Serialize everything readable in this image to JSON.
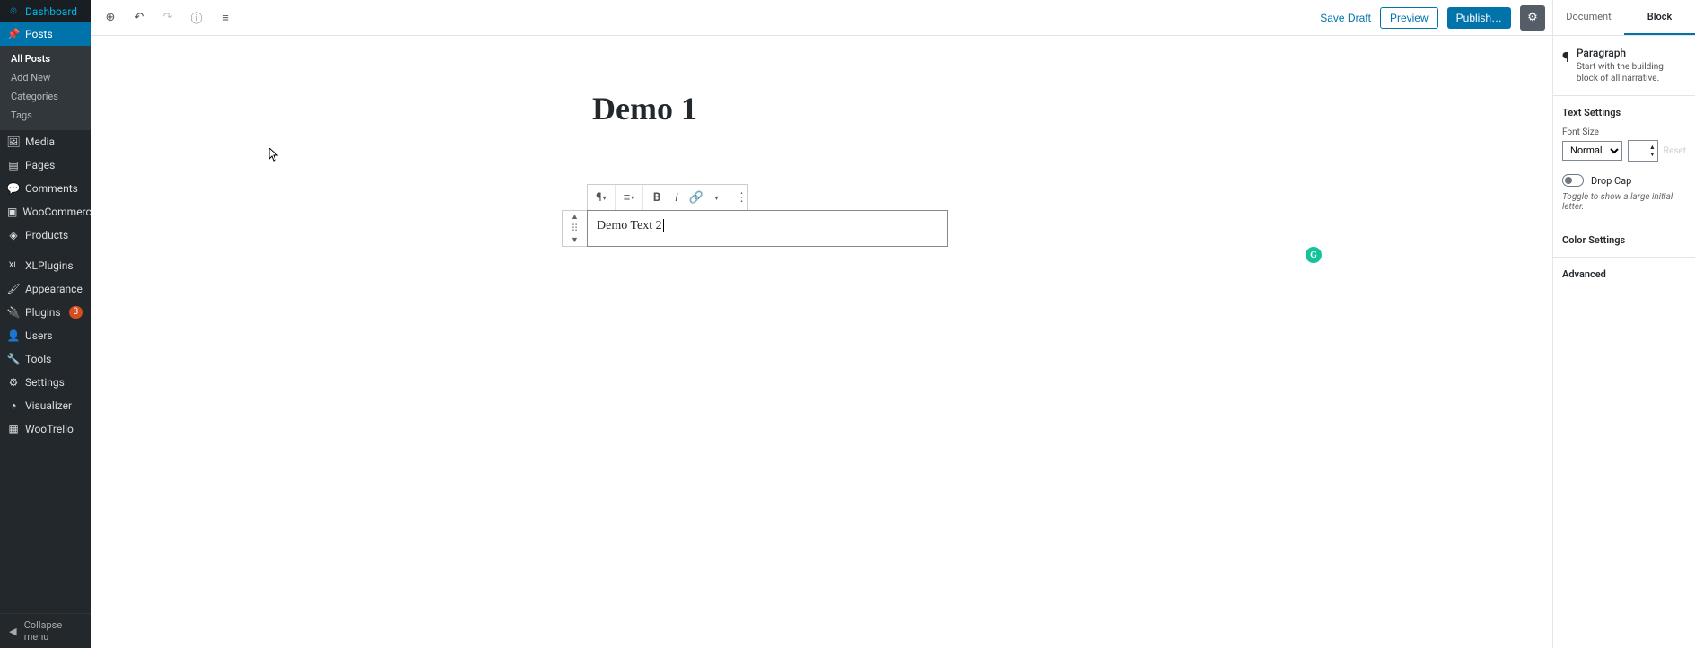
{
  "sidebar": {
    "dashboard": "Dashboard",
    "posts": "Posts",
    "posts_sub": [
      "All Posts",
      "Add New",
      "Categories",
      "Tags"
    ],
    "media": "Media",
    "pages": "Pages",
    "comments": "Comments",
    "woocommerce": "WooCommerce",
    "products": "Products",
    "xlplugins": "XLPlugins",
    "appearance": "Appearance",
    "plugins": "Plugins",
    "plugins_badge": "3",
    "users": "Users",
    "tools": "Tools",
    "settings": "Settings",
    "visualizer": "Visualizer",
    "wootrello": "WooTrello",
    "collapse": "Collapse menu"
  },
  "topbar": {
    "save_draft": "Save Draft",
    "preview": "Preview",
    "publish": "Publish…"
  },
  "editor": {
    "title": "Demo 1",
    "block_text": "Demo Text 2"
  },
  "inspector": {
    "tab_document": "Document",
    "tab_block": "Block",
    "block_name": "Paragraph",
    "block_desc": "Start with the building block of all narrative.",
    "text_settings": "Text Settings",
    "font_size_label": "Font Size",
    "font_size_value": "Normal",
    "reset": "Reset",
    "drop_cap": "Drop Cap",
    "drop_cap_hint": "Toggle to show a large initial letter.",
    "color_settings": "Color Settings",
    "advanced": "Advanced"
  }
}
